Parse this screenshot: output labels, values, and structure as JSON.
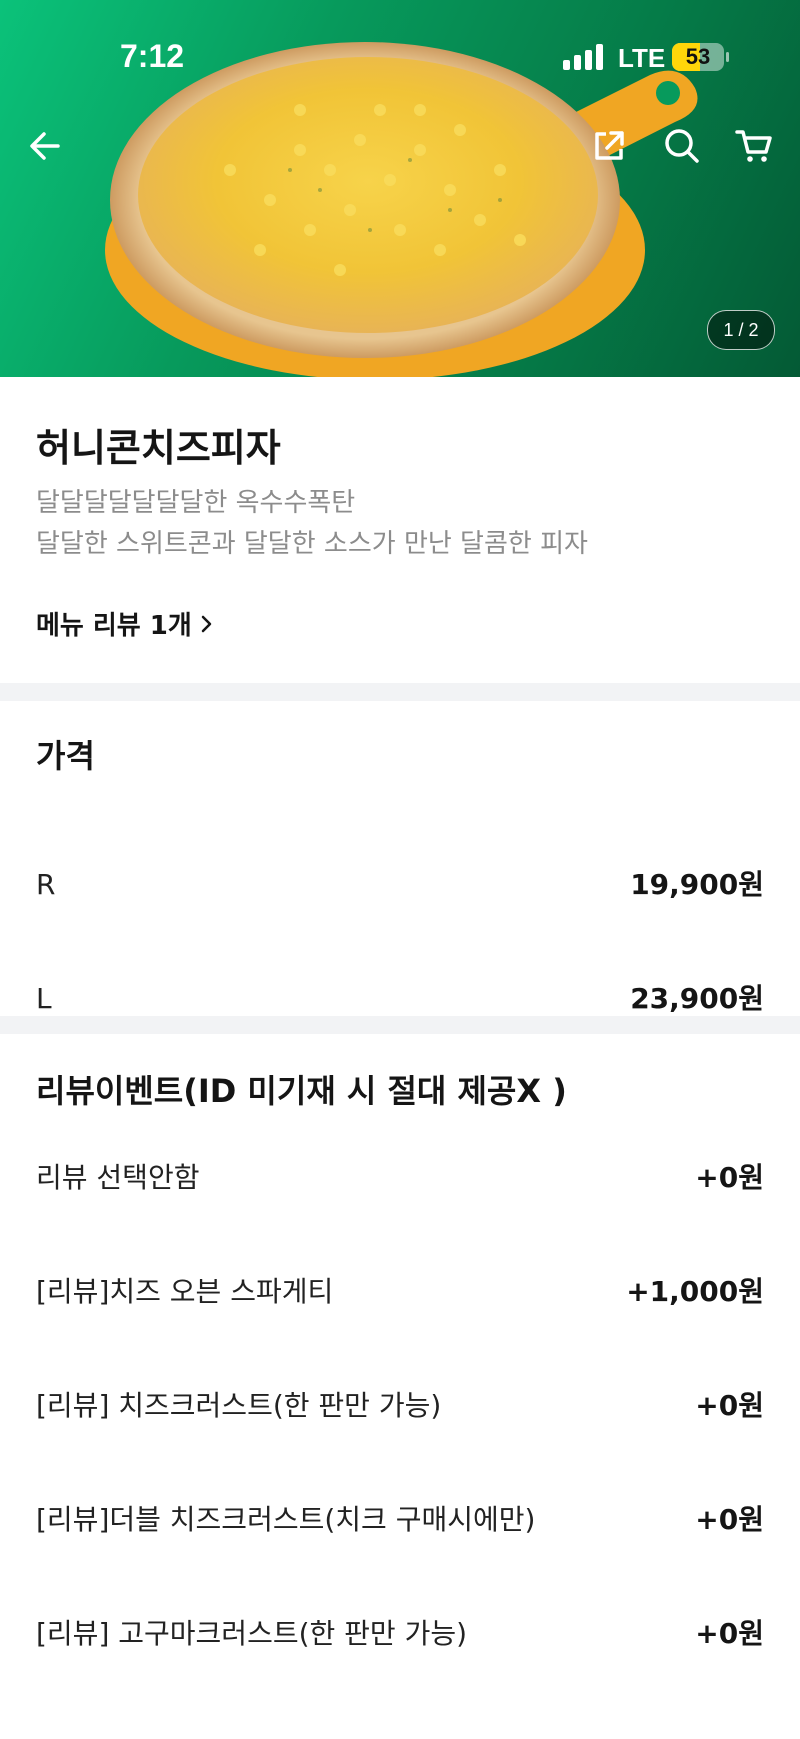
{
  "status_bar": {
    "time": "7:12",
    "network": "LTE",
    "battery": "53",
    "battery_level": 0.53
  },
  "hero": {
    "page_counter": "1 / 2",
    "current_page": 1,
    "total_pages": 2
  },
  "nav": {
    "back_icon": "arrow-left-icon",
    "share_icon": "share-icon",
    "search_icon": "search-icon",
    "cart_icon": "cart-icon"
  },
  "menu": {
    "name": "허니콘치즈피자",
    "description": [
      "달달달달달달달한 옥수수폭탄",
      "달달한 스위트콘과 달달한 소스가 만난 달콤한 피자"
    ],
    "review_link": "메뉴 리뷰 1개"
  },
  "price_section": {
    "title": "가격",
    "options": [
      {
        "label": "R",
        "price": "19,900원"
      },
      {
        "label": "L",
        "price": "23,900원"
      }
    ]
  },
  "review_event_section": {
    "title": "리뷰이벤트(ID 미기재 시 절대 제공X )",
    "options": [
      {
        "label": "리뷰 선택안함",
        "price": "+0원"
      },
      {
        "label": "[리뷰]치즈 오븐 스파게티",
        "price": "+1,000원"
      },
      {
        "label": "[리뷰] 치즈크러스트(한 판만 가능)",
        "price": "+0원"
      },
      {
        "label": "[리뷰]더블 치즈크러스트(치크 구매시에만)",
        "price": "+0원"
      },
      {
        "label": "[리뷰] 고구마크러스트(한 판만 가능)",
        "price": "+0원"
      }
    ]
  },
  "colors": {
    "hero_green": "#079a5c",
    "text_primary": "#151515",
    "text_secondary": "#8c8c8c",
    "divider": "#f2f3f5",
    "battery": "#ffd60a"
  }
}
